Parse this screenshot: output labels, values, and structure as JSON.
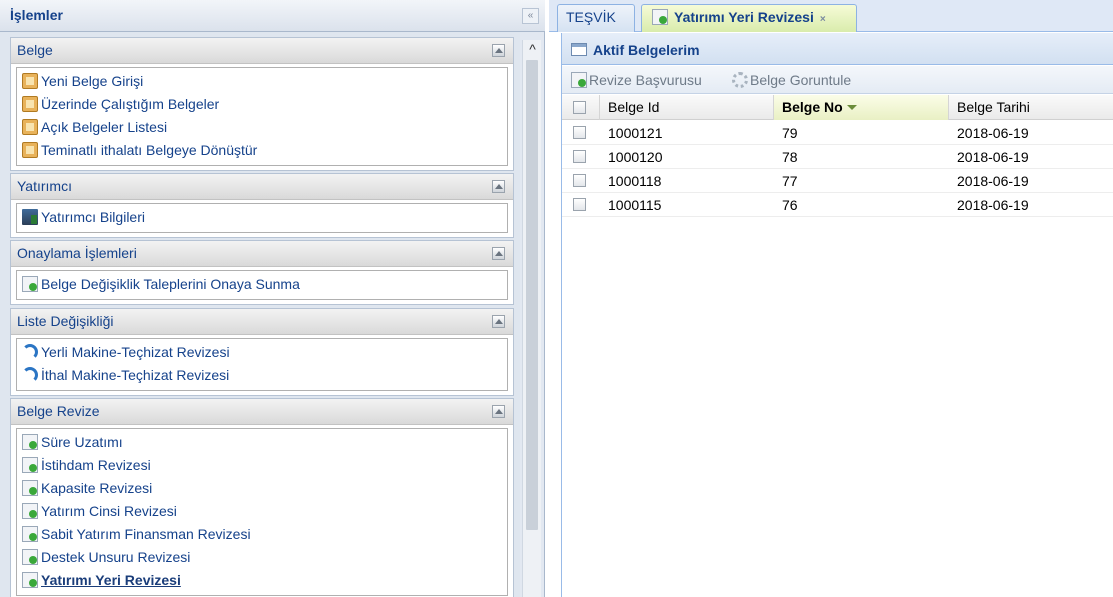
{
  "left_panel": {
    "title": "İşlemler",
    "collapse_label": "«",
    "groups": [
      {
        "title": "Belge",
        "items": [
          {
            "label": "Yeni Belge Girişi",
            "icon": "document-icon"
          },
          {
            "label": "Üzerinde Çalıştığım Belgeler",
            "icon": "document-icon"
          },
          {
            "label": "Açık Belgeler Listesi",
            "icon": "document-icon"
          },
          {
            "label": "Teminatlı ithalatı Belgeye Dönüştür",
            "icon": "document-icon"
          }
        ]
      },
      {
        "title": "Yatırımcı",
        "items": [
          {
            "label": "Yatırımcı Bilgileri",
            "icon": "building-icon"
          }
        ]
      },
      {
        "title": "Onaylama İşlemleri",
        "items": [
          {
            "label": "Belge Değişiklik Taleplerini Onaya Sunma",
            "icon": "page-add-icon"
          }
        ]
      },
      {
        "title": "Liste Değişikliği",
        "items": [
          {
            "label": "Yerli Makine-Teçhizat Revizesi",
            "icon": "refresh-arrow-icon"
          },
          {
            "label": "İthal Makine-Teçhizat Revizesi",
            "icon": "refresh-arrow-icon"
          }
        ]
      },
      {
        "title": "Belge Revize",
        "items": [
          {
            "label": "Süre Uzatımı",
            "icon": "page-add-icon"
          },
          {
            "label": "İstihdam Revizesi",
            "icon": "page-add-icon"
          },
          {
            "label": "Kapasite Revizesi",
            "icon": "page-add-icon"
          },
          {
            "label": "Yatırım Cinsi Revizesi",
            "icon": "page-add-icon"
          },
          {
            "label": "Sabit Yatırım Finansman Revizesi",
            "icon": "page-add-icon"
          },
          {
            "label": "Destek Unsuru Revizesi",
            "icon": "page-add-icon"
          },
          {
            "label": "Yatırımı Yeri Revizesi",
            "icon": "page-add-icon",
            "active": true
          }
        ]
      }
    ]
  },
  "tabs": [
    {
      "label": "TEŞVİK",
      "active": false
    },
    {
      "label": "Yatırımı Yeri Revizesi",
      "active": true,
      "close_label": "×"
    }
  ],
  "grid": {
    "title": "Aktif Belgelerim",
    "toolbar": {
      "revize_label": "Revize Başvurusu",
      "belge_label": "Belge Goruntule"
    },
    "columns": [
      "Belge Id",
      "Belge No",
      "Belge Tarihi"
    ],
    "sorted_column": "Belge No",
    "rows": [
      {
        "id": "1000121",
        "no": "79",
        "date": "2018-06-19"
      },
      {
        "id": "1000120",
        "no": "78",
        "date": "2018-06-19"
      },
      {
        "id": "1000118",
        "no": "77",
        "date": "2018-06-19"
      },
      {
        "id": "1000115",
        "no": "76",
        "date": "2018-06-19"
      }
    ]
  },
  "colors": {
    "header_text": "#15428b",
    "active_tab": "#d9ecac",
    "panel_bg": "#dfe6ef"
  }
}
